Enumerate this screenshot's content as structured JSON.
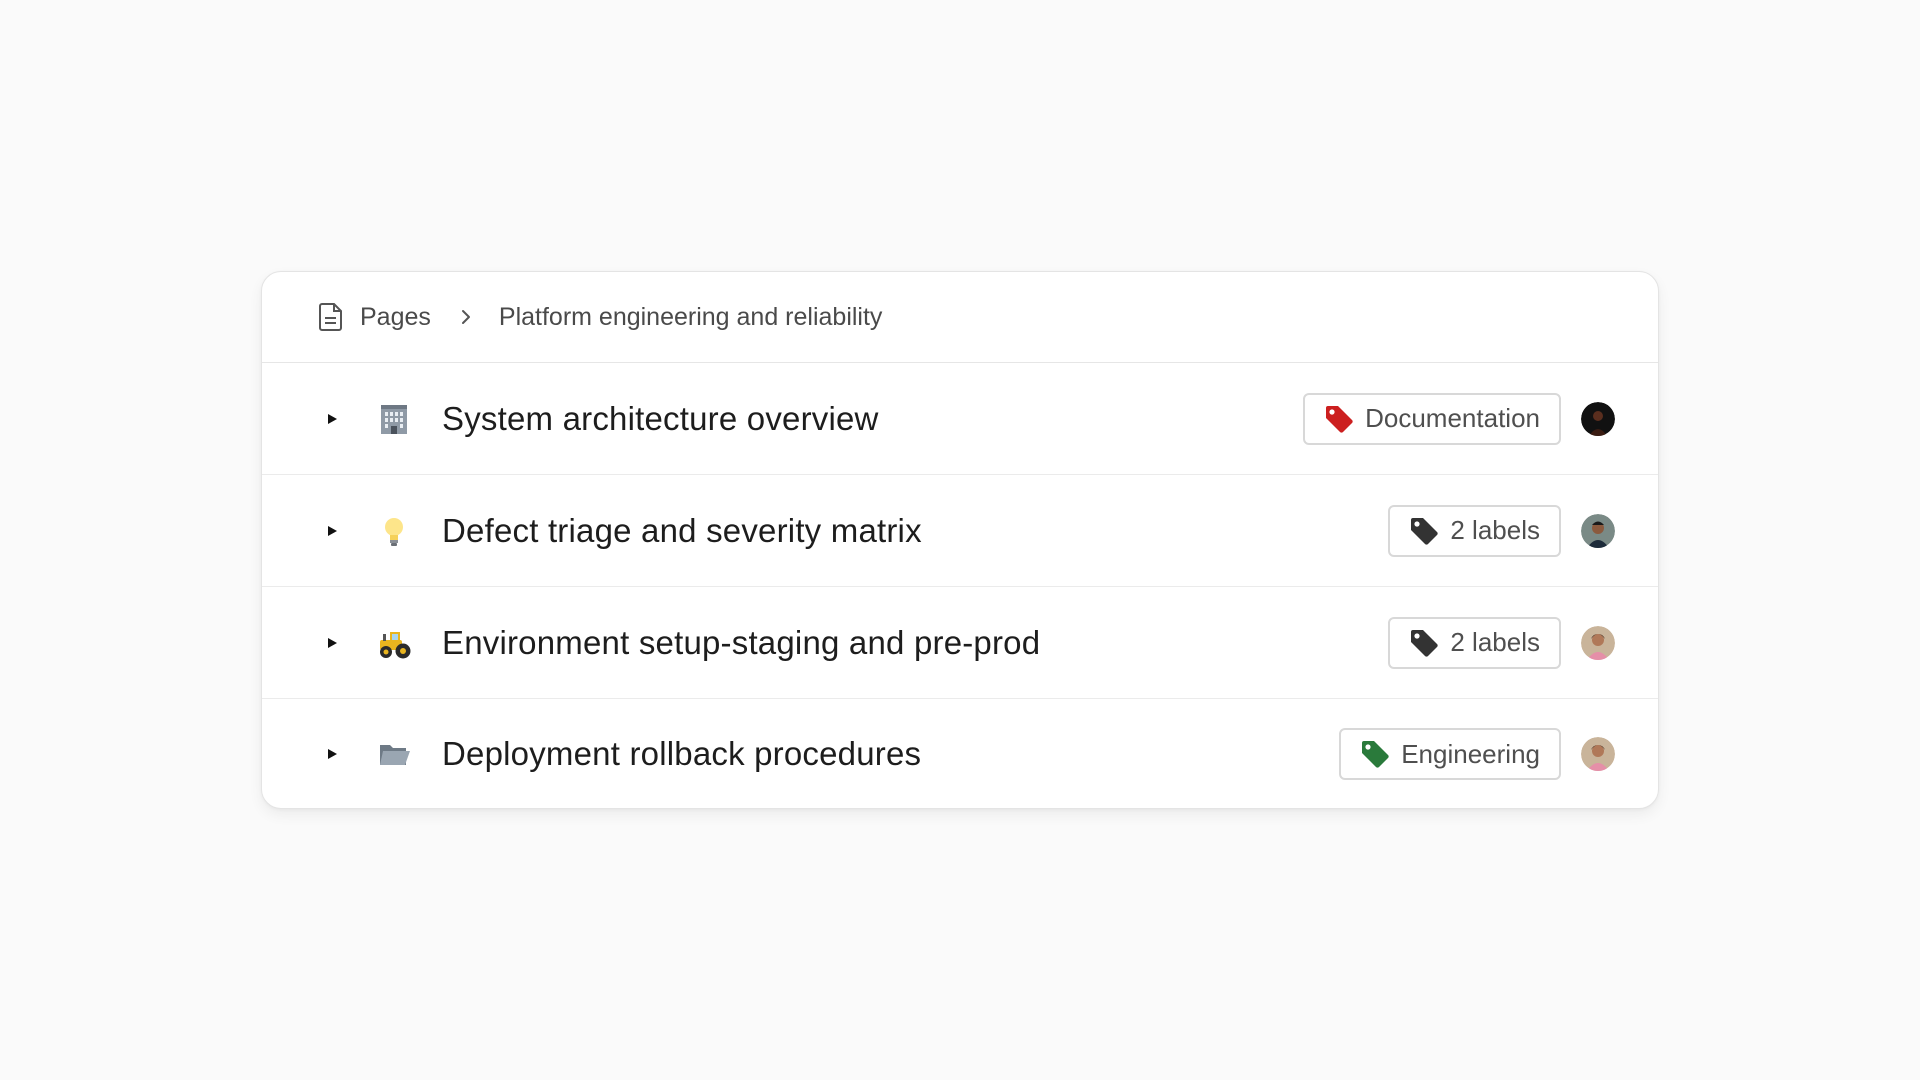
{
  "breadcrumb": {
    "icon": "document-icon",
    "root": "Pages",
    "current": "Platform engineering and reliability"
  },
  "rows": [
    {
      "emoji": "office-building-icon",
      "title": "System architecture overview",
      "tag": {
        "label": "Documentation",
        "icon": "tag-icon",
        "color": "#cc1f1f"
      },
      "avatar": "avatar-dark"
    },
    {
      "emoji": "light-bulb-icon",
      "title": "Defect triage and severity matrix",
      "tag": {
        "label": "2 labels",
        "icon": "tags-icon",
        "color": "#333333"
      },
      "avatar": "avatar-man"
    },
    {
      "emoji": "tractor-icon",
      "title": "Environment setup-staging and pre-prod",
      "tag": {
        "label": "2 labels",
        "icon": "tags-icon",
        "color": "#333333"
      },
      "avatar": "avatar-woman"
    },
    {
      "emoji": "open-folder-icon",
      "title": "Deployment rollback procedures",
      "tag": {
        "label": "Engineering",
        "icon": "tag-icon",
        "color": "#2a7a3b"
      },
      "avatar": "avatar-woman"
    }
  ]
}
